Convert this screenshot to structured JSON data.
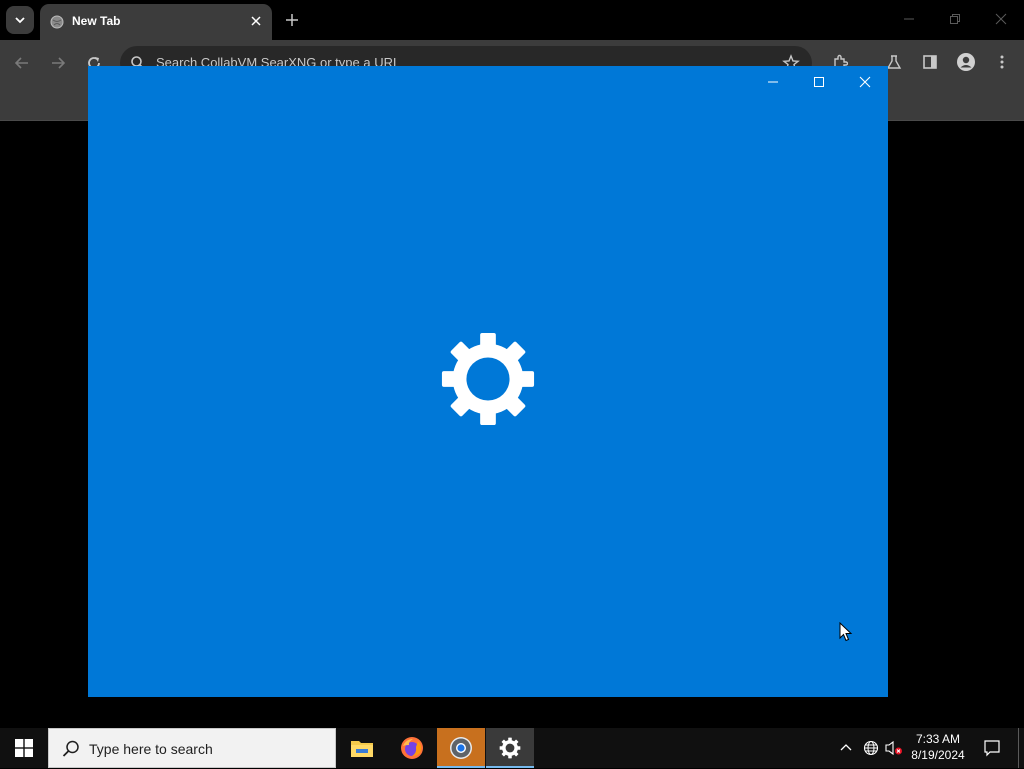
{
  "browser": {
    "tab": {
      "title": "New Tab",
      "favicon": "globe-icon"
    },
    "omnibox": {
      "placeholder": "Search CollabVM SearXNG or type a URL"
    },
    "icons": [
      "tab-search-icon",
      "close-icon",
      "new-tab-icon",
      "minimize-icon",
      "restore-icon",
      "back-icon",
      "forward-icon",
      "reload-icon",
      "star-icon",
      "extensions-icon",
      "labs-icon",
      "side-panel-icon",
      "profile-icon",
      "menu-icon"
    ]
  },
  "settings_window": {
    "accent_color": "#0078d7",
    "splash_icon": "gear-icon",
    "controls": [
      "minimize-icon",
      "maximize-icon",
      "close-icon"
    ]
  },
  "taskbar": {
    "search_placeholder": "Type here to search",
    "apps": [
      {
        "name": "File Explorer",
        "icon": "folder-icon"
      },
      {
        "name": "Firefox",
        "icon": "firefox-icon"
      },
      {
        "name": "Chrome",
        "icon": "chrome-icon"
      },
      {
        "name": "Settings",
        "icon": "gear-icon"
      }
    ],
    "tray": {
      "time": "7:33 AM",
      "date": "8/19/2024"
    }
  }
}
